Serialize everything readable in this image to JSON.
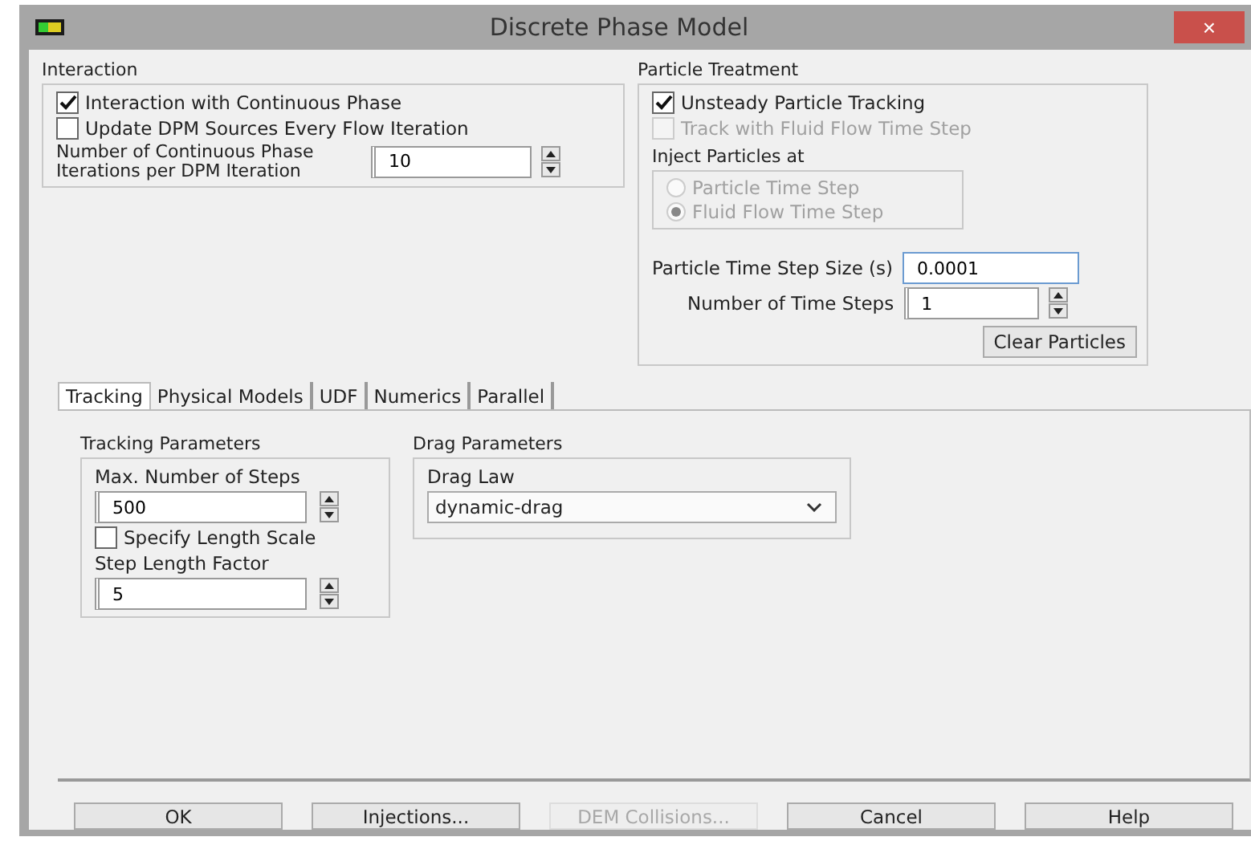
{
  "window": {
    "title": "Discrete Phase Model",
    "close": "×"
  },
  "interaction": {
    "title": "Interaction",
    "checkboxes": [
      {
        "label": "Interaction with Continuous Phase",
        "checked": true,
        "disabled": false
      },
      {
        "label": "Update DPM Sources Every Flow Iteration",
        "checked": false,
        "disabled": false
      }
    ],
    "iterations": {
      "label": "Number of Continuous Phase Iterations per DPM Iteration",
      "value": "10"
    }
  },
  "particle_treatment": {
    "title": "Particle Treatment",
    "checkboxes": [
      {
        "label": "Unsteady Particle Tracking",
        "checked": true,
        "disabled": false
      },
      {
        "label": "Track with Fluid Flow Time Step",
        "checked": false,
        "disabled": true
      }
    ],
    "inject": {
      "title": "Inject Particles at",
      "options": [
        {
          "label": "Particle Time Step",
          "selected": false,
          "disabled": true
        },
        {
          "label": "Fluid Flow Time Step",
          "selected": true,
          "disabled": true
        }
      ]
    },
    "time_step_size": {
      "label": "Particle Time Step Size (s)",
      "value": "0.0001"
    },
    "num_time_steps": {
      "label": "Number of Time Steps",
      "value": "1"
    },
    "clear_button": "Clear Particles"
  },
  "tabs": [
    {
      "label": "Tracking",
      "selected": true
    },
    {
      "label": "Physical Models",
      "selected": false
    },
    {
      "label": "UDF",
      "selected": false
    },
    {
      "label": "Numerics",
      "selected": false
    },
    {
      "label": "Parallel",
      "selected": false
    }
  ],
  "tracking_parameters": {
    "title": "Tracking Parameters",
    "max_steps": {
      "label": "Max. Number of Steps",
      "value": "500"
    },
    "length_scale": {
      "label": "Specify Length Scale",
      "checked": false
    },
    "step_length_factor": {
      "label": "Step Length Factor",
      "value": "5"
    }
  },
  "drag_parameters": {
    "title": "Drag Parameters",
    "drag_law": {
      "label": "Drag Law",
      "value": "dynamic-drag"
    }
  },
  "buttons": [
    {
      "label": "OK",
      "disabled": false
    },
    {
      "label": "Injections...",
      "disabled": false
    },
    {
      "label": "DEM Collisions...",
      "disabled": true
    },
    {
      "label": "Cancel",
      "disabled": false
    },
    {
      "label": "Help",
      "disabled": false
    }
  ]
}
